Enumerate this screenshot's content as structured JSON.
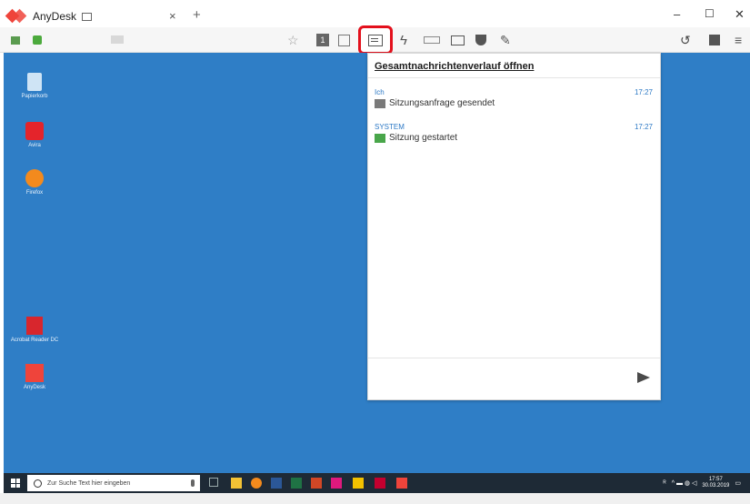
{
  "app": {
    "tab_title": "AnyDesk",
    "tab_close": "×",
    "new_tab": "+",
    "window_controls": {
      "minimize": "–",
      "maximize": "☐",
      "close": "✕"
    }
  },
  "toolbar": {
    "icons": [
      "monitor-icon",
      "connection-icon",
      "favorite-star-icon",
      "display-1-icon",
      "transfer-icon",
      "chat-icon",
      "actions-icon",
      "keyboard-icon",
      "screen-icon",
      "permissions-icon",
      "whiteboard-icon",
      "history-icon",
      "save-icon",
      "menu-icon"
    ],
    "display_number": "1",
    "highlight_color": "#e3101c"
  },
  "chat": {
    "header": "Gesamtnachrichtenverlauf öffnen",
    "messages": [
      {
        "sender": "Ich",
        "time": "17:27",
        "text": "Sitzungsanfrage gesendet",
        "icon": "user-icon"
      },
      {
        "sender": "SYSTEM",
        "time": "17:27",
        "text": "Sitzung gestartet",
        "icon": "monitor-check-icon"
      }
    ],
    "send_icon": "send-icon"
  },
  "desktop": {
    "background": "#2f7ec6",
    "icons": [
      {
        "label": "Papierkorb",
        "icon": "recycle-bin-icon"
      },
      {
        "label": "Avira",
        "icon": "avira-icon"
      },
      {
        "label": "Firefox",
        "icon": "firefox-icon"
      },
      {
        "label": "Acrobat Reader DC",
        "icon": "acrobat-icon"
      },
      {
        "label": "AnyDesk",
        "icon": "anydesk-icon"
      }
    ]
  },
  "taskbar": {
    "search_placeholder": "Zur Suche Text hier eingeben",
    "clock_time": "17:57",
    "clock_date": "30.03.2019"
  }
}
